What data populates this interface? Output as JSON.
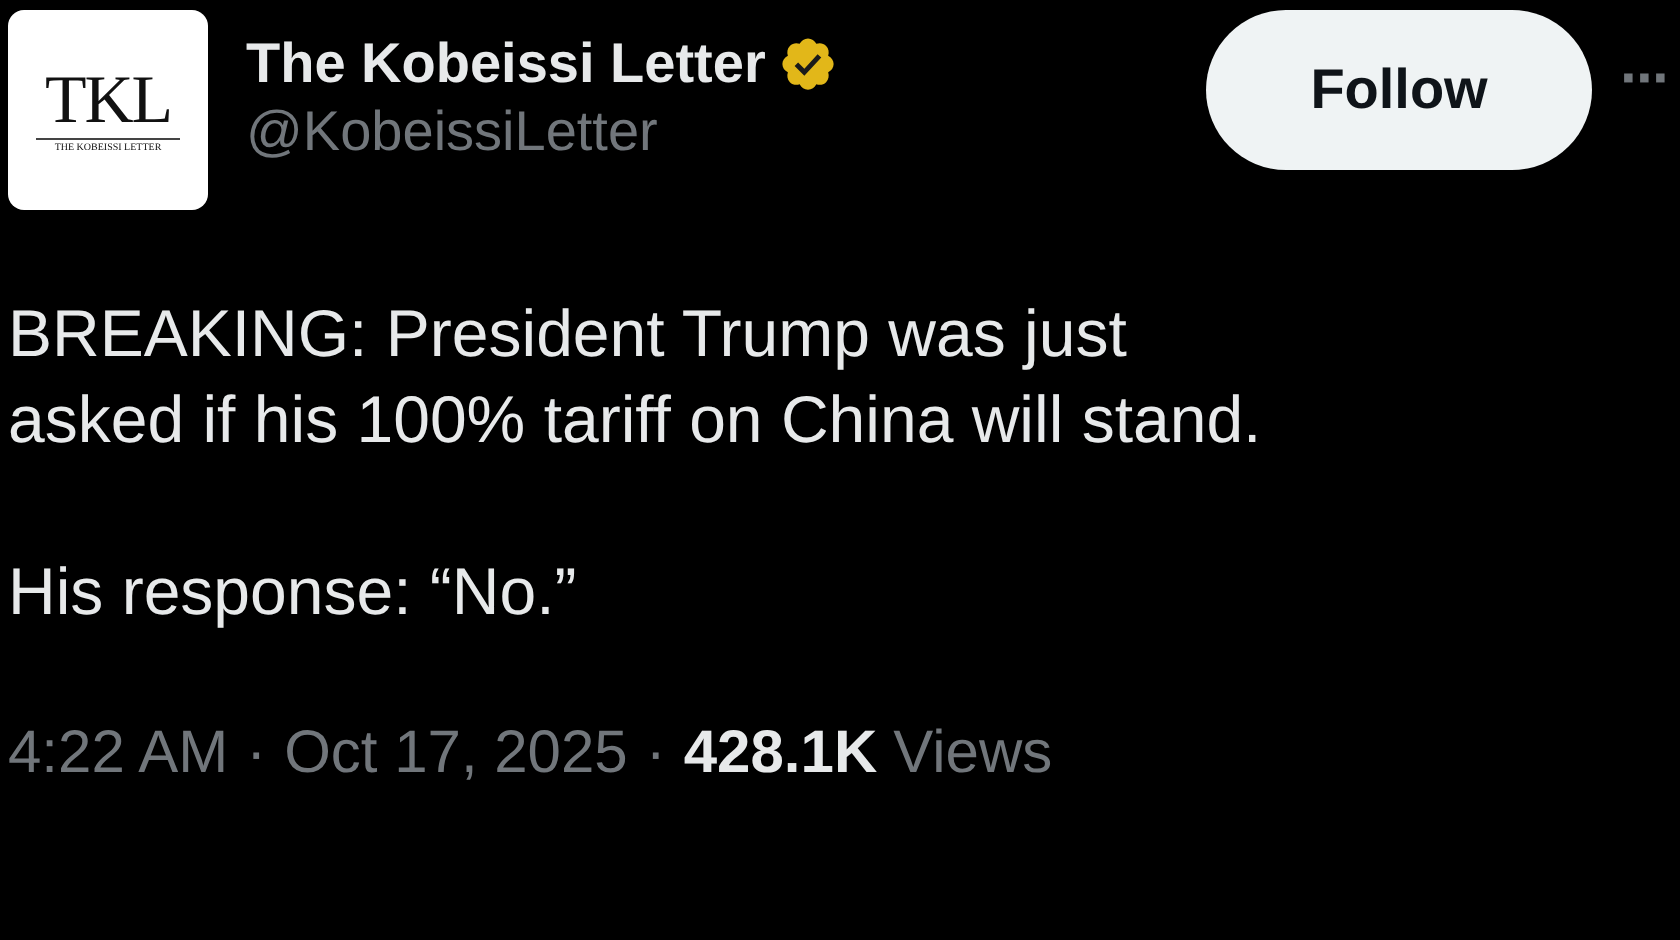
{
  "author": {
    "avatar_logo": {
      "initials": "TKL",
      "caption": "THE KOBEISSI LETTER"
    },
    "name": "The Kobeissi Letter",
    "verified": true,
    "handle": "@KobeissiLetter"
  },
  "follow_button": "Follow",
  "more_button": "···",
  "paragraphs": [
    [
      "BREAKING: President Trump was just",
      "asked if his 100% tariff on China will stand."
    ],
    [
      "His response: “No.”"
    ]
  ],
  "meta": {
    "time": "4:22 AM",
    "separator": "·",
    "date": "Oct 17, 2025",
    "views_count": "428.1K",
    "views_label": "Views"
  }
}
